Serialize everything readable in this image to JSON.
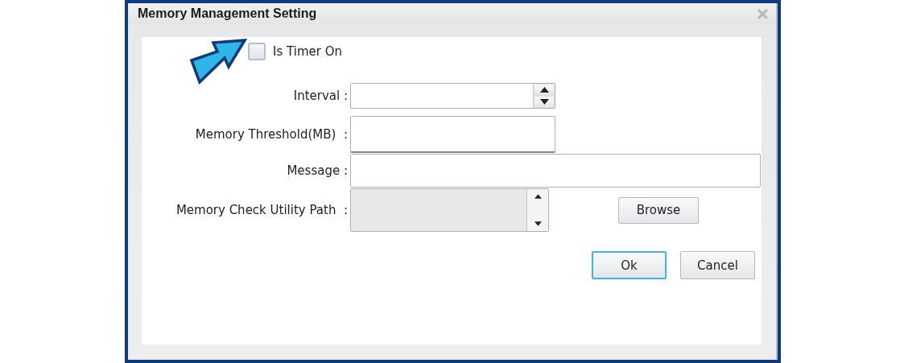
{
  "window": {
    "title": "Memory Management Setting"
  },
  "timer": {
    "label": "Is Timer On",
    "checked": false
  },
  "fields": [
    {
      "kind": "spinner",
      "label": "Interval :",
      "disabled": false
    },
    {
      "kind": "text",
      "label": "Memory Threshold(MB)  :",
      "disabled": false
    },
    {
      "kind": "wide",
      "label": "Message :",
      "disabled": false
    },
    {
      "kind": "path",
      "label": "Memory Check Utility Path  :",
      "disabled": true,
      "action": "Browse"
    }
  ],
  "buttons": [
    {
      "label": "Ok",
      "focused": true
    },
    {
      "label": "Cancel",
      "focused": false
    }
  ]
}
